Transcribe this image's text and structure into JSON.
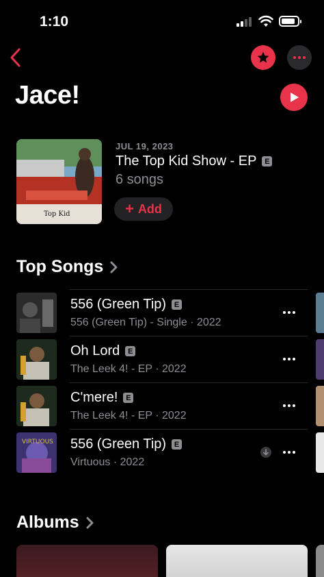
{
  "status_bar": {
    "time": "1:10"
  },
  "nav": {
    "back_icon": "chevron-left-icon",
    "favorite_icon": "star-icon",
    "more_icon": "ellipsis-icon"
  },
  "artist": {
    "name": "Jace!"
  },
  "latest_release": {
    "date": "JUL 19, 2023",
    "title": "The Top Kid Show - EP",
    "explicit": "E",
    "song_count": "6 songs",
    "add_label": "Add",
    "add_icon": "plus-icon"
  },
  "top_songs": {
    "title": "Top Songs",
    "items": [
      {
        "title": "556 (Green Tip)",
        "explicit": "E",
        "subtitle": "556 (Green Tip) - Single · 2022",
        "downloaded": false
      },
      {
        "title": "Oh Lord",
        "explicit": "E",
        "subtitle": "The Leek 4! - EP · 2022",
        "downloaded": false
      },
      {
        "title": "C'mere!",
        "explicit": "E",
        "subtitle": "The Leek 4! - EP · 2022",
        "downloaded": false
      },
      {
        "title": "556 (Green Tip)",
        "explicit": "E",
        "subtitle": "Virtuous · 2022",
        "downloaded": true
      }
    ]
  },
  "albums": {
    "title": "Albums"
  },
  "colors": {
    "accent": "#e8334a",
    "background": "#000000",
    "secondary_text": "#8e8e93"
  }
}
